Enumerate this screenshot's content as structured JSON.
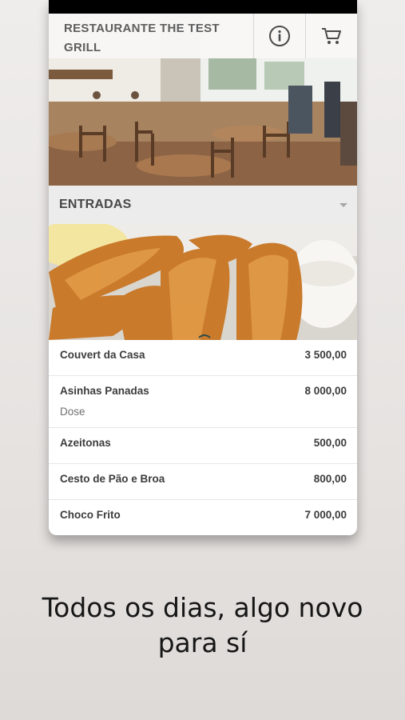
{
  "header": {
    "title": "RESTAURANTE THE TEST GRILL",
    "info_icon": "info-icon",
    "cart_icon": "cart-icon"
  },
  "section": {
    "title": "ENTRADAS",
    "caret_icon": "caret-down-icon"
  },
  "menu": {
    "items": [
      {
        "name": "Couvert da Casa",
        "price": "3 500,00",
        "sub": ""
      },
      {
        "name": "Asinhas Panadas",
        "price": "8 000,00",
        "sub": "Dose"
      },
      {
        "name": "Azeitonas",
        "price": "500,00",
        "sub": ""
      },
      {
        "name": "Cesto de Pão e Broa",
        "price": "800,00",
        "sub": ""
      },
      {
        "name": "Choco Frito",
        "price": "7 000,00",
        "sub": ""
      }
    ]
  },
  "tagline": {
    "line1": "Todos os dias, algo novo",
    "line2": "para sí"
  }
}
